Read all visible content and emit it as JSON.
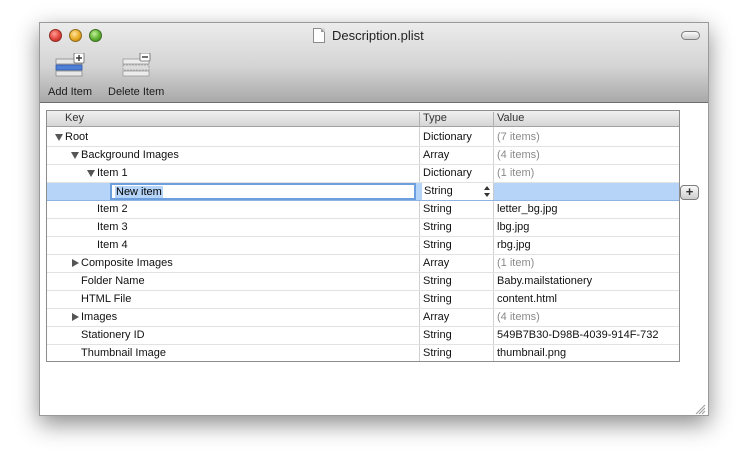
{
  "window": {
    "title": "Description.plist"
  },
  "toolbar": {
    "add_item_label": "Add Item",
    "delete_item_label": "Delete Item"
  },
  "columns": {
    "key": "Key",
    "type": "Type",
    "value": "Value"
  },
  "edit": {
    "value": "New item",
    "type": "String"
  },
  "rows": [
    {
      "key": "Root",
      "type": "Dictionary",
      "value": "(7 items)"
    },
    {
      "key": "Background Images",
      "type": "Array",
      "value": "(4 items)"
    },
    {
      "key": "Item 1",
      "type": "Dictionary",
      "value": "(1 item)"
    },
    {
      "key": "New item",
      "type": "String",
      "value": ""
    },
    {
      "key": "Item 2",
      "type": "String",
      "value": "letter_bg.jpg"
    },
    {
      "key": "Item 3",
      "type": "String",
      "value": "lbg.jpg"
    },
    {
      "key": "Item 4",
      "type": "String",
      "value": "rbg.jpg"
    },
    {
      "key": "Composite Images",
      "type": "Array",
      "value": "(1 item)"
    },
    {
      "key": "Folder Name",
      "type": "String",
      "value": "Baby.mailstationery"
    },
    {
      "key": "HTML File",
      "type": "String",
      "value": "content.html"
    },
    {
      "key": "Images",
      "type": "Array",
      "value": "(4 items)"
    },
    {
      "key": "Stationery ID",
      "type": "String",
      "value": "549B7B30-D98B-4039-914F-732"
    },
    {
      "key": "Thumbnail Image",
      "type": "String",
      "value": "thumbnail.png"
    }
  ],
  "colors": {
    "selection": "#b6d4f8",
    "edit_border": "#6d9fde"
  }
}
